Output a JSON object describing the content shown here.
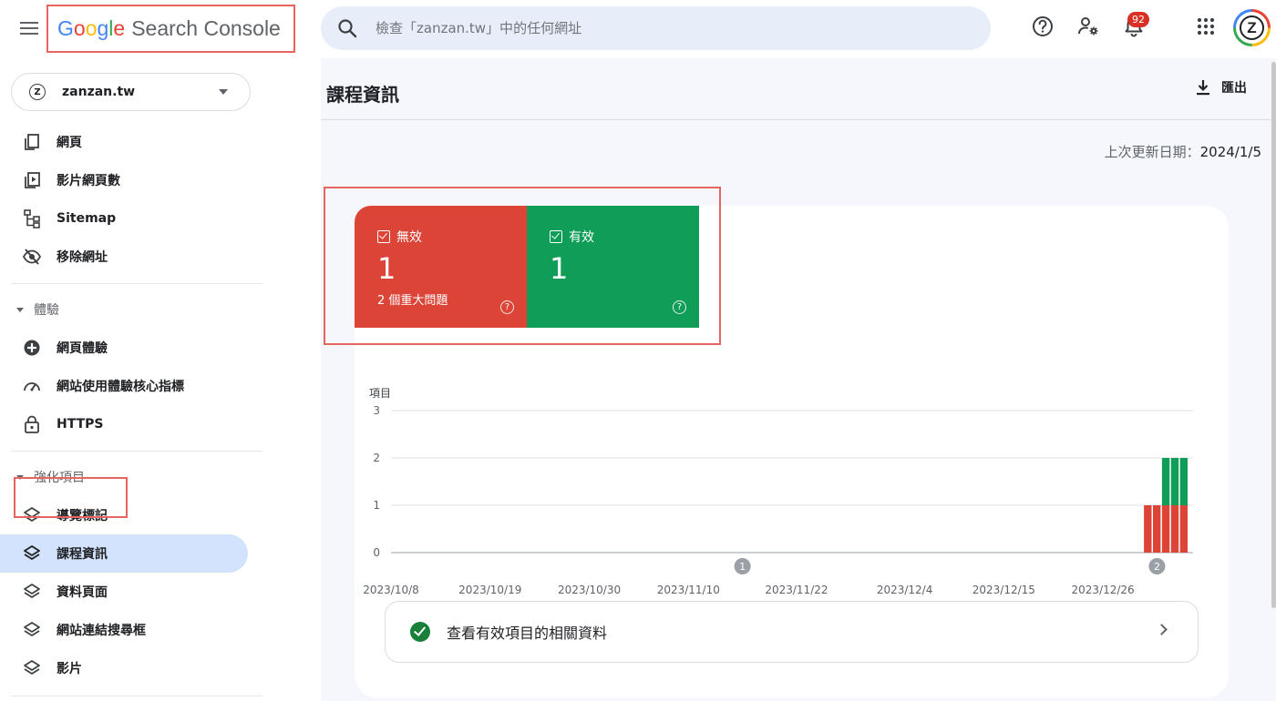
{
  "app": {
    "logo_parts": [
      "G",
      "o",
      "o",
      "g",
      "l",
      "e"
    ],
    "product": "Search Console"
  },
  "search": {
    "placeholder": "檢查「zanzan.tw」中的任何網址"
  },
  "notifications": {
    "count": "92"
  },
  "avatar": {
    "initial": "Z"
  },
  "sidebar": {
    "property": "zanzan.tw",
    "items": [
      {
        "label": "網頁",
        "icon": "pages-icon"
      },
      {
        "label": "影片網頁數",
        "icon": "video-pages-icon"
      },
      {
        "label": "Sitemap",
        "icon": "sitemap-icon"
      },
      {
        "label": "移除網址",
        "icon": "removals-icon"
      }
    ],
    "sections": [
      {
        "title": "體驗",
        "items": [
          {
            "label": "網頁體驗",
            "icon": "page-experience-icon"
          },
          {
            "label": "網站使用體驗核心指標",
            "icon": "core-web-vitals-icon"
          },
          {
            "label": "HTTPS",
            "icon": "lock-icon"
          }
        ]
      },
      {
        "title": "強化項目",
        "items": [
          {
            "label": "導覽標記",
            "icon": "layers-icon"
          },
          {
            "label": "課程資訊",
            "icon": "layers-icon",
            "active": true
          },
          {
            "label": "資料頁面",
            "icon": "layers-icon"
          },
          {
            "label": "網站連結搜尋框",
            "icon": "layers-icon"
          },
          {
            "label": "影片",
            "icon": "layers-icon"
          }
        ]
      }
    ]
  },
  "page": {
    "title": "課程資訊",
    "export_label": "匯出",
    "updated_label": "上次更新日期：",
    "updated_date": "2024/1/5"
  },
  "tiles": {
    "invalid": {
      "label": "無效",
      "count": "1",
      "sub": "2 個重大問題",
      "help": "?"
    },
    "valid": {
      "label": "有效",
      "count": "1",
      "help": "?"
    }
  },
  "colors": {
    "invalid": "#db4437",
    "valid": "#0f9d58",
    "accent": "#1a73e8",
    "active_nav": "#d3e3fd"
  },
  "chart_data": {
    "type": "bar",
    "ylabel": "項目",
    "ylim": [
      0,
      3
    ],
    "yticks": [
      0,
      1,
      2,
      3
    ],
    "xticks": [
      "2023/10/8",
      "2023/10/19",
      "2023/10/30",
      "2023/11/10",
      "2023/11/22",
      "2023/12/4",
      "2023/12/15",
      "2023/12/26"
    ],
    "x_start": "2023/10/8",
    "x_end": "2024/1/5",
    "series": [
      {
        "name": "無效",
        "color": "#db4437",
        "points": [
          {
            "x": "2023/12/31",
            "y": 1
          },
          {
            "x": "2024/1/1",
            "y": 1
          },
          {
            "x": "2024/1/2",
            "y": 1
          },
          {
            "x": "2024/1/3",
            "y": 1
          },
          {
            "x": "2024/1/4",
            "y": 1
          }
        ]
      },
      {
        "name": "有效",
        "color": "#0f9d58",
        "points": [
          {
            "x": "2024/1/2",
            "y": 1
          },
          {
            "x": "2024/1/3",
            "y": 1
          },
          {
            "x": "2024/1/4",
            "y": 1
          }
        ]
      }
    ],
    "annotations": [
      {
        "label": "1",
        "x": "2023/11/16"
      },
      {
        "label": "2",
        "x": "2024/1/1"
      }
    ],
    "grid": true
  },
  "cta": {
    "label": "查看有效項目的相關資料"
  }
}
